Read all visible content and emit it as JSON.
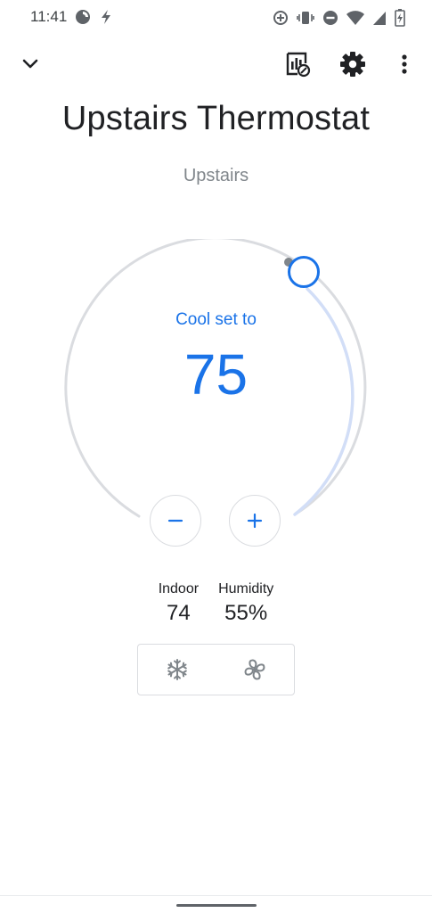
{
  "status_bar": {
    "time": "11:41",
    "left_icons": [
      "data-saver-icon",
      "flash-icon"
    ],
    "right_icons": [
      "add-circle-icon",
      "vibrate-icon",
      "do-not-disturb-icon",
      "wifi-icon",
      "signal-icon",
      "battery-icon"
    ]
  },
  "toolbar": {
    "back_icon": "chevron-down-icon",
    "history_icon": "energy-history-icon",
    "settings_icon": "gear-icon",
    "more_icon": "more-vert-icon"
  },
  "device": {
    "title": "Upstairs Thermostat",
    "room": "Upstairs"
  },
  "dial": {
    "mode_label": "Cool set to",
    "setpoint": "75",
    "accent_color": "#1a73e8",
    "track_color": "#dadce0"
  },
  "controls": {
    "decrease_label": "−",
    "increase_label": "+"
  },
  "stats": {
    "indoor_label": "Indoor",
    "indoor_value": "74",
    "humidity_label": "Humidity",
    "humidity_value": "55%"
  },
  "modes": {
    "cool_icon": "snowflake-icon",
    "fan_icon": "fan-icon"
  }
}
